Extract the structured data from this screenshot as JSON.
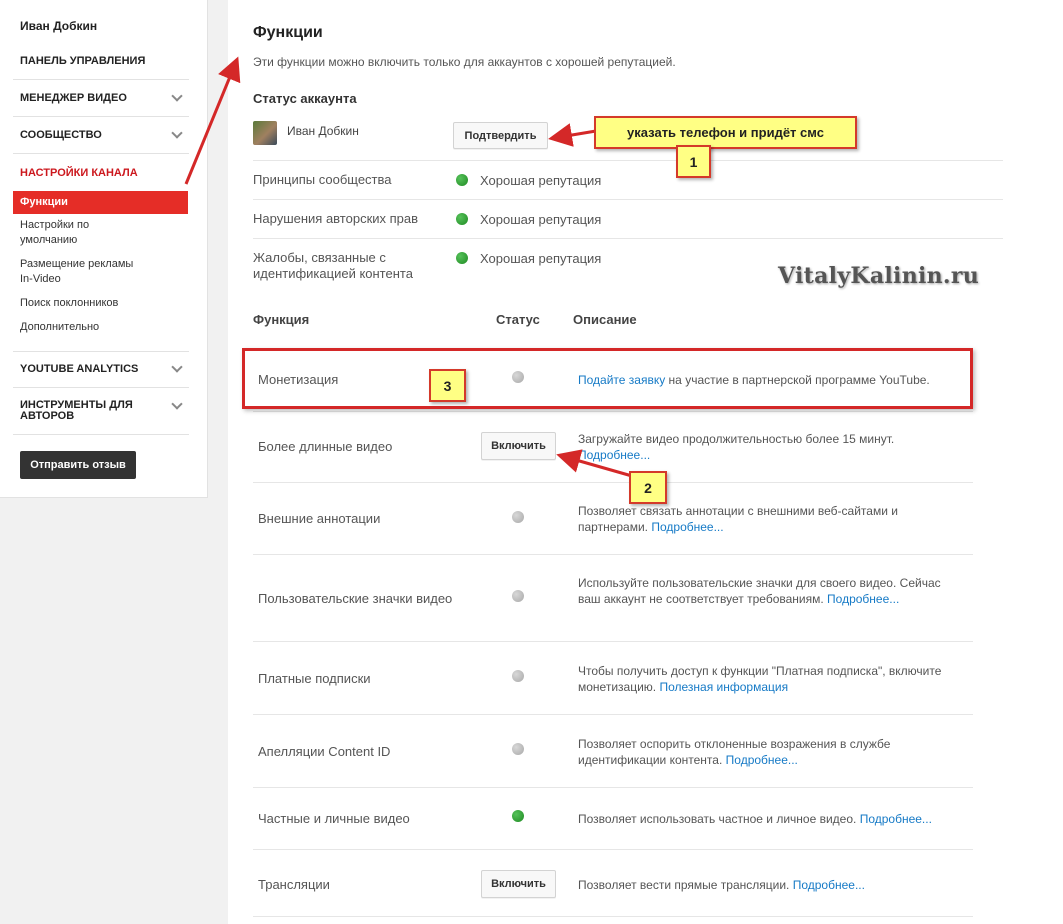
{
  "sidebar": {
    "user_name": "Иван Добкин",
    "sections": [
      {
        "label": "ПАНЕЛЬ УПРАВЛЕНИЯ"
      },
      {
        "label": "МЕНЕДЖЕР ВИДЕО"
      },
      {
        "label": "СООБЩЕСТВО"
      },
      {
        "label": "НАСТРОЙКИ КАНАЛА"
      },
      {
        "label": "YOUTUBE ANALYTICS"
      },
      {
        "label": "ИНСТРУМЕНТЫ ДЛЯ АВТОРОВ"
      }
    ],
    "channel_items": [
      {
        "label": "Функции"
      },
      {
        "label": "Настройки по умолчанию"
      },
      {
        "label": "Размещение рекламы In-Video"
      },
      {
        "label": "Поиск поклонников"
      },
      {
        "label": "Дополнительно"
      }
    ],
    "feedback_button": "Отправить отзыв"
  },
  "main": {
    "title": "Функции",
    "subtitle": "Эти функции можно включить только для аккаунтов с хорошей репутацией.",
    "account_status": {
      "heading": "Статус аккаунта",
      "user_name": "Иван Добкин",
      "confirm_button": "Подтвердить",
      "rows": [
        {
          "label": "Принципы сообщества",
          "status": "Хорошая репутация"
        },
        {
          "label": "Нарушения авторских прав",
          "status": "Хорошая репутация"
        },
        {
          "label": "Жалобы, связанные с идентификацией контента",
          "status": "Хорошая репутация"
        }
      ]
    },
    "features_table": {
      "headers": {
        "feature": "Функция",
        "status": "Статус",
        "description": "Описание"
      },
      "rows": [
        {
          "name": "Монетизация",
          "status": "inactive",
          "link": "Подайте заявку",
          "text": " на участие в партнерской программе YouTube."
        },
        {
          "name": "Более длинные видео",
          "button": "Включить",
          "text": "Загружайте видео продолжительностью более 15 минут.",
          "link": "Подробнее..."
        },
        {
          "name": "Внешние аннотации",
          "status": "inactive",
          "text": "Позволяет связать аннотации с внешними веб-сайтами и партнерами.",
          "link": "Подробнее..."
        },
        {
          "name": "Пользовательские значки видео",
          "status": "inactive",
          "text": "Используйте пользовательские значки для своего видео. Сейчас ваш аккаунт не соответствует требованиям.",
          "link": "Подробнее..."
        },
        {
          "name": "Платные подписки",
          "status": "inactive",
          "text": "Чтобы получить доступ к функции \"Платная подписка\", включите монетизацию.",
          "link": "Полезная информация"
        },
        {
          "name": "Апелляции Content ID",
          "status": "inactive",
          "text": "Позволяет оспорить отклоненные возражения в службе идентификации контента.",
          "link": "Подробнее..."
        },
        {
          "name": "Частные и личные видео",
          "status": "active",
          "text": "Позволяет использовать частное и личное видео.",
          "link": "Подробнее..."
        },
        {
          "name": "Трансляции",
          "button": "Включить",
          "text": "Позволяет вести прямые трансляции.",
          "link": "Подробнее..."
        }
      ]
    }
  },
  "annotations": {
    "watermark": "VitalyKalinin.ru",
    "callout_text": "указать телефон и придёт смс",
    "marker_1": "1",
    "marker_2": "2",
    "marker_3": "3"
  },
  "colors": {
    "accent_red": "#e52d27",
    "link_blue": "#167ac6",
    "status_green": "#2a9d2e",
    "callout_yellow": "#ffff84"
  }
}
